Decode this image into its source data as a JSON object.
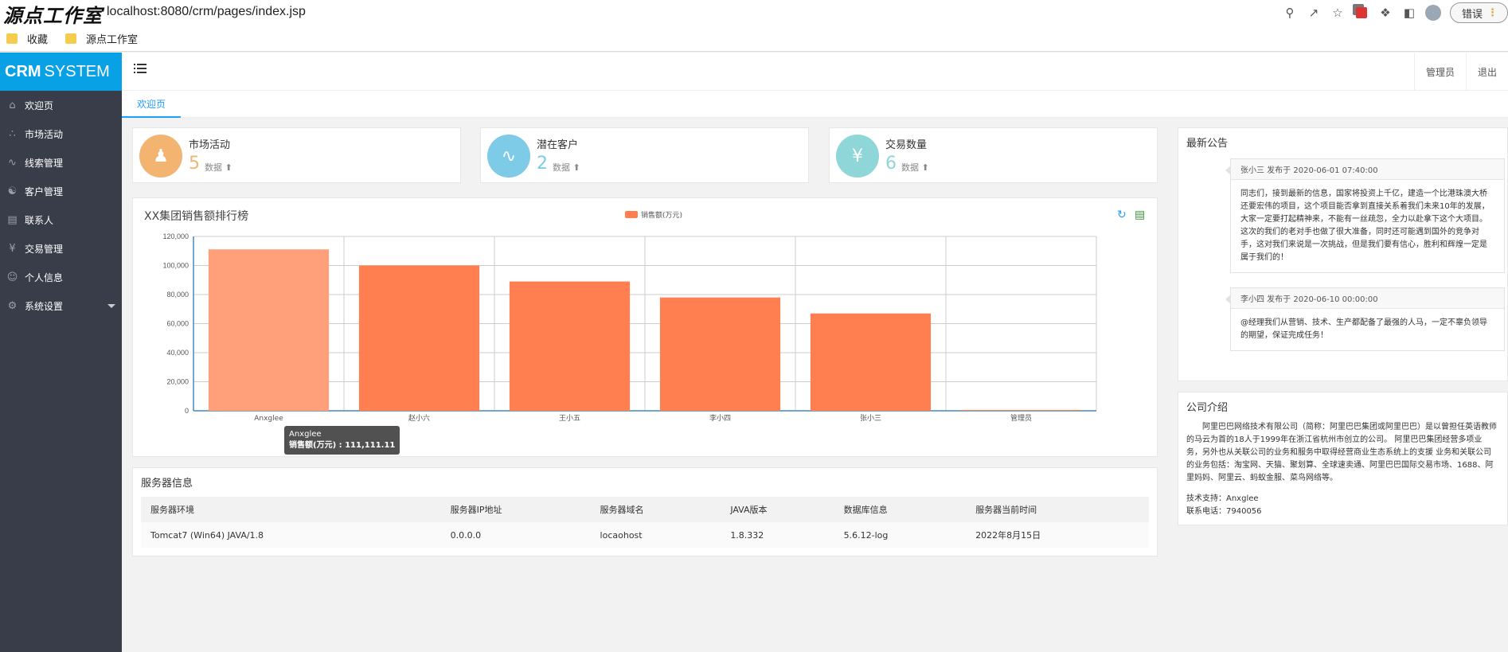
{
  "browser": {
    "watermark": "源点工作室",
    "url": "localhost:8080/crm/pages/index.jsp",
    "error_button": "错误",
    "bookmarks": [
      "收藏",
      "源点工作室"
    ]
  },
  "sidebar": {
    "logo_bold": "CRM",
    "logo_rest": "SYSTEM",
    "items": [
      {
        "label": "欢迎页",
        "icon": "home-icon"
      },
      {
        "label": "市场活动",
        "icon": "network-icon"
      },
      {
        "label": "线索管理",
        "icon": "chart-icon"
      },
      {
        "label": "客户管理",
        "icon": "users-icon"
      },
      {
        "label": "联系人",
        "icon": "contact-card-icon"
      },
      {
        "label": "交易管理",
        "icon": "yen-icon"
      },
      {
        "label": "个人信息",
        "icon": "user-icon"
      },
      {
        "label": "系统设置",
        "icon": "gear-icon"
      }
    ]
  },
  "header": {
    "admin_label": "管理员",
    "logout_label": "退出"
  },
  "tabs": {
    "active": "欢迎页"
  },
  "stats": [
    {
      "title": "市场活动",
      "value": "5",
      "unit": "数据",
      "color": "#f3b472",
      "icon": "people-icon"
    },
    {
      "title": "潜在客户",
      "value": "2",
      "unit": "数据",
      "color": "#7ecbe8",
      "icon": "route-icon"
    },
    {
      "title": "交易数量",
      "value": "6",
      "unit": "数据",
      "color": "#8fd6d8",
      "icon": "yen-refresh-icon"
    }
  ],
  "chart": {
    "title": "XX集团销售额排行榜",
    "legend": "销售额(万元)",
    "tooltip_name": "Anxglee",
    "tooltip_value": "销售额(万元) : 111,111.11"
  },
  "chart_data": {
    "type": "bar",
    "title": "XX集团销售额排行榜",
    "categories": [
      "Anxglee",
      "赵小六",
      "王小五",
      "李小四",
      "张小三",
      "管理员"
    ],
    "series": [
      {
        "name": "销售额(万元)",
        "values": [
          111111.11,
          100000,
          89000,
          78000,
          67000,
          0
        ]
      }
    ],
    "ylim": [
      0,
      120000
    ],
    "yticks": [
      "0",
      "20,000",
      "40,000",
      "60,000",
      "80,000",
      "100,000",
      "120,000"
    ],
    "grid": true,
    "legend_position": "top-center",
    "colors": {
      "bar": "#ff7f50",
      "bar_highlight": "#ffa07a"
    }
  },
  "server": {
    "title": "服务器信息",
    "headers": [
      "服务器环境",
      "服务器IP地址",
      "服务器域名",
      "JAVA版本",
      "数据库信息",
      "服务器当前时间"
    ],
    "row": [
      "Tomcat7 (Win64) JAVA/1.8",
      "0.0.0.0",
      "locaohost",
      "1.8.332",
      "5.6.12-log",
      "2022年8月15日"
    ]
  },
  "notices": {
    "title": "最新公告",
    "items": [
      {
        "header": "张小三 发布于 2020-06-01 07:40:00",
        "body": "同志们，接到最新的信息，国家将投资上千亿，建造一个比港珠澳大桥还要宏伟的项目，这个项目能否拿到直接关系着我们未来10年的发展，大家一定要打起精神来，不能有一丝疏忽，全力以赴拿下这个大项目。这次的我们的老对手也做了很大准备，同时还可能遇到国外的竞争对手，这对我们来说是一次挑战，但是我们要有信心，胜利和辉煌一定是属于我们的！"
      },
      {
        "header": "李小四 发布于 2020-06-10 00:00:00",
        "body": "@经理我们从营销、技术、生产都配备了最强的人马，一定不辜负领导的期望，保证完成任务！"
      }
    ]
  },
  "company": {
    "title": "公司介绍",
    "intro": "阿里巴巴网络技术有限公司（简称：阿里巴巴集团或阿里巴巴）是以曾担任英语教师的马云为首的18人于1999年在浙江省杭州市创立的公司。 阿里巴巴集团经营多项业务，另外也从关联公司的业务和服务中取得经营商业生态系统上的支援 业务和关联公司的业务包括：淘宝网、天猫、聚划算、全球速卖通、阿里巴巴国际交易市场、1688、阿里妈妈、阿里云、蚂蚁金服、菜鸟网络等。",
    "support": "技术支持：Anxglee",
    "phone": "联系电话：7940056"
  }
}
